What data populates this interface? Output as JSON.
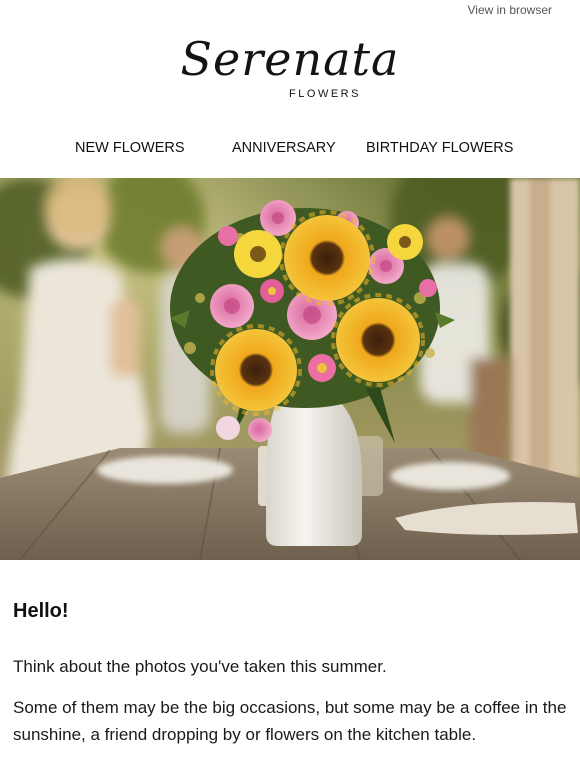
{
  "header": {
    "view_in_browser": "View in browser",
    "brand_script": "Serenata",
    "brand_sub": "FLOWERS"
  },
  "nav": {
    "items": [
      {
        "label": "NEW FLOWERS"
      },
      {
        "label": "ANNIVERSARY"
      },
      {
        "label": "BIRTHDAY FLOWERS"
      }
    ]
  },
  "hero": {
    "alt": "Bouquet of sunflowers and pink roses in a white vase on an outdoor table"
  },
  "body": {
    "greeting": "Hello!",
    "paragraph_1": "Think about the photos you've taken this summer.",
    "paragraph_2": "Some of them may be the big occasions, but some may be a coffee in the sunshine, a friend dropping by or flowers on the kitchen table."
  },
  "colors": {
    "text": "#111111",
    "muted_link": "#555555",
    "background": "#ffffff"
  }
}
